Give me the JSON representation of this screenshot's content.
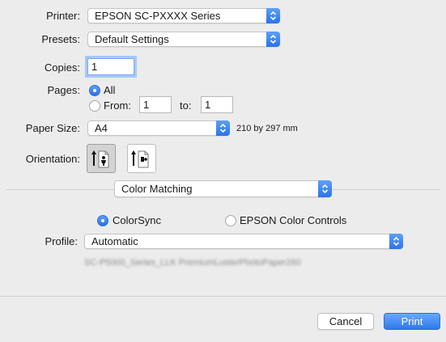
{
  "printer": {
    "label": "Printer:",
    "value": "EPSON SC-PXXXX Series"
  },
  "presets": {
    "label": "Presets:",
    "value": "Default Settings"
  },
  "copies": {
    "label": "Copies:",
    "value": "1"
  },
  "pages": {
    "label": "Pages:",
    "all_label": "All",
    "from_label": "From:",
    "from_value": "1",
    "to_label": "to:",
    "to_value": "1",
    "selected": "All"
  },
  "paper_size": {
    "label": "Paper Size:",
    "value": "A4",
    "dimensions": "210 by 297 mm"
  },
  "orientation": {
    "label": "Orientation:",
    "selected": "portrait"
  },
  "section": {
    "value": "Color Matching"
  },
  "color_mode": {
    "options": [
      "ColorSync",
      "EPSON Color Controls"
    ],
    "selected": "ColorSync"
  },
  "profile": {
    "label": "Profile:",
    "value": "Automatic",
    "description": "SC-P5000_Series_LLK PremiumLusterPhotoPaper260"
  },
  "buttons": {
    "cancel": "Cancel",
    "print": "Print"
  },
  "colors": {
    "accent": "#2a72ec",
    "background": "#ececec"
  }
}
